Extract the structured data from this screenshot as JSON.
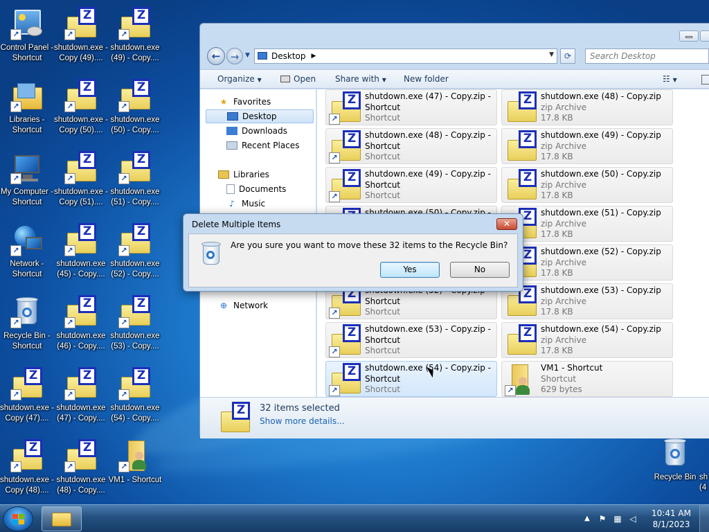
{
  "desktop": {
    "icons": [
      {
        "label": "Control Panel - Shortcut"
      },
      {
        "label": "shutdown.exe - Copy (49)...."
      },
      {
        "label": "shutdown.exe (49) - Copy...."
      },
      {
        "label": "Libraries - Shortcut"
      },
      {
        "label": "shutdown.exe - Copy (50)...."
      },
      {
        "label": "shutdown.exe (50) - Copy...."
      },
      {
        "label": "My Computer - Shortcut"
      },
      {
        "label": "shutdown.exe - Copy (51)...."
      },
      {
        "label": "shutdown.exe (51) - Copy...."
      },
      {
        "label": "Network - Shortcut"
      },
      {
        "label": "shutdown.exe (45) - Copy...."
      },
      {
        "label": "shutdown.exe (52) - Copy...."
      },
      {
        "label": "Recycle Bin - Shortcut"
      },
      {
        "label": "shutdown.exe (46) - Copy...."
      },
      {
        "label": "shutdown.exe (53) - Copy...."
      },
      {
        "label": "shutdown.exe - Copy (47)...."
      },
      {
        "label": "shutdown.exe (47) - Copy...."
      },
      {
        "label": "shutdown.exe (54) - Copy...."
      },
      {
        "label": "shutdown.exe - Copy (48)...."
      },
      {
        "label": "shutdown.exe (48) - Copy...."
      },
      {
        "label": "VM1 - Shortcut"
      },
      {
        "label": "Recycle Bin"
      },
      {
        "label": "sh (4"
      }
    ]
  },
  "explorer": {
    "address": "Desktop",
    "search_placeholder": "Search Desktop",
    "toolbar": {
      "organize": "Organize",
      "open": "Open",
      "share": "Share with",
      "new_folder": "New folder"
    },
    "nav": {
      "favorites": "Favorites",
      "desktop": "Desktop",
      "downloads": "Downloads",
      "recent": "Recent Places",
      "libraries": "Libraries",
      "documents": "Documents",
      "music": "Music",
      "network": "Network"
    },
    "files": [
      {
        "name": "shutdown.exe (47) - Copy.zip - Shortcut",
        "sub": "Shortcut"
      },
      {
        "name": "shutdown.exe (48) - Copy.zip",
        "sub": "zip Archive",
        "size": "17.8 KB"
      },
      {
        "name": "shutdown.exe (48) - Copy.zip - Shortcut",
        "sub": "Shortcut"
      },
      {
        "name": "shutdown.exe (49) - Copy.zip",
        "sub": "zip Archive",
        "size": "17.8 KB"
      },
      {
        "name": "shutdown.exe (49) - Copy.zip - Shortcut",
        "sub": "Shortcut"
      },
      {
        "name": "shutdown.exe (50) - Copy.zip",
        "sub": "zip Archive",
        "size": "17.8 KB"
      },
      {
        "name": "shutdown.exe (50) - Copy.zip -",
        "sub": ""
      },
      {
        "name": "shutdown.exe (51) - Copy.zip",
        "sub": "zip Archive",
        "size": "17.8 KB"
      },
      {
        "name": "",
        "sub": ""
      },
      {
        "name": "shutdown.exe (52) - Copy.zip",
        "sub": "zip Archive",
        "size": "17.8 KB"
      },
      {
        "name": "shutdown.exe (52) - Copy.zip - Shortcut",
        "sub": "Shortcut"
      },
      {
        "name": "shutdown.exe (53) - Copy.zip",
        "sub": "zip Archive",
        "size": "17.8 KB"
      },
      {
        "name": "shutdown.exe (53) - Copy.zip - Shortcut",
        "sub": "Shortcut"
      },
      {
        "name": "shutdown.exe (54) - Copy.zip",
        "sub": "zip Archive",
        "size": "17.8 KB"
      },
      {
        "name": "shutdown.exe (54) - Copy.zip - Shortcut",
        "sub": "Shortcut"
      },
      {
        "name": "VM1 - Shortcut",
        "sub": "Shortcut",
        "size": "629 bytes"
      }
    ],
    "details": {
      "title": "32 items selected",
      "link": "Show more details..."
    }
  },
  "dialog": {
    "title": "Delete Multiple Items",
    "message": "Are you sure you want to move these 32 items to the Recycle Bin?",
    "yes": "Yes",
    "no": "No",
    "close": "✕"
  },
  "taskbar": {
    "time": "10:41 AM",
    "date": "8/1/2023"
  },
  "colors": {
    "accent": "#1b2fb8",
    "selection": "#d3e7fb"
  }
}
